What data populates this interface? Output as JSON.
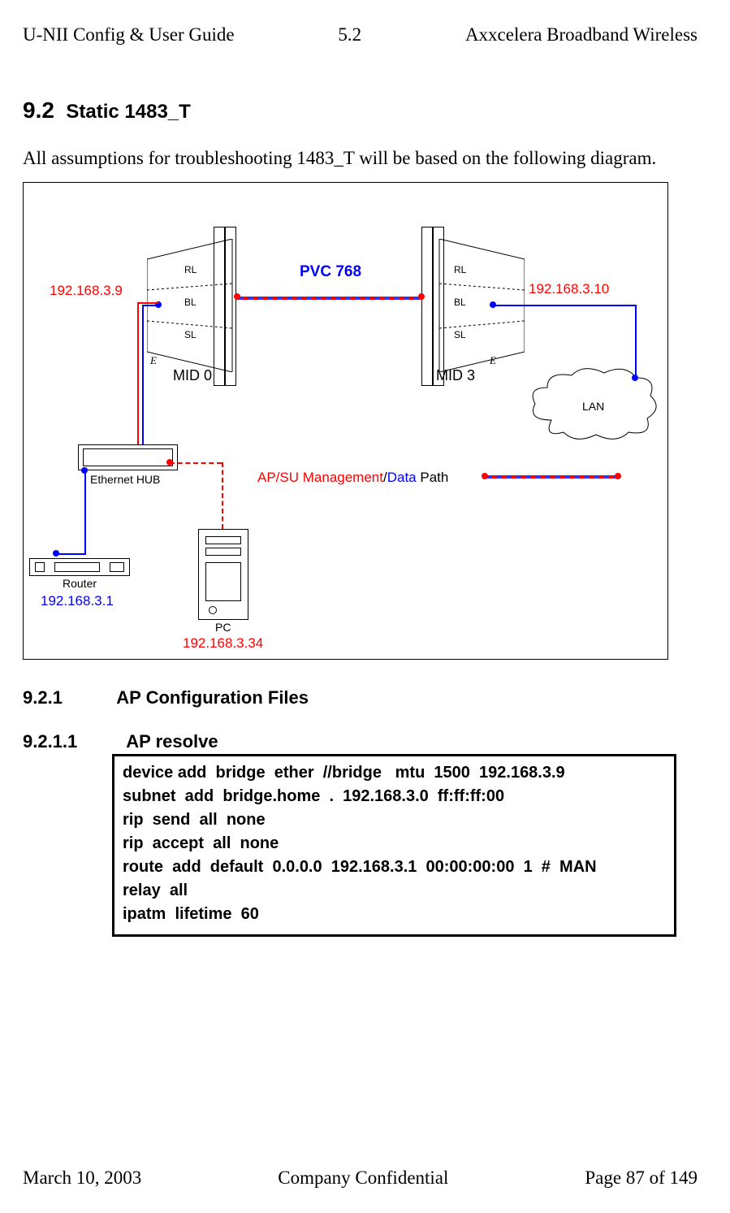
{
  "header": {
    "left": "U-NII Config & User Guide",
    "center": "5.2",
    "right": "Axxcelera Broadband Wireless"
  },
  "sec92": {
    "num": "9.2",
    "title": "Static 1483_T"
  },
  "intro": "All assumptions for troubleshooting 1483_T will be based on the following diagram.",
  "diagram": {
    "pvc": "PVC 768",
    "ip_ap": "192.168.3.9",
    "ip_su": "192.168.3.10",
    "e1": "E",
    "e2": "E",
    "mid0": "MID 0",
    "mid3": "MID 3",
    "rl1": "RL",
    "bl1": "BL",
    "sl1": "SL",
    "rl2": "RL",
    "bl2": "BL",
    "sl2": "SL",
    "hub_label": "Ethernet HUB",
    "path_ap": "AP/SU  ",
    "path_m": "Management",
    "path_sep": "/",
    "path_d": "Data ",
    "path_p": "Path",
    "router_label": "Router",
    "router_ip": "192.168.3.1",
    "pc_label": "PC",
    "pc_ip": "192.168.3.34",
    "lan": "LAN"
  },
  "sec921": {
    "num": "9.2.1",
    "title": "AP Configuration Files"
  },
  "sec9211": {
    "num": "9.2.1.1",
    "title": "AP resolve"
  },
  "code": "device add  bridge  ether  //bridge   mtu  1500  192.168.3.9\nsubnet  add  bridge.home  .  192.168.3.0  ff:ff:ff:00\nrip  send  all  none\nrip  accept  all  none\nroute  add  default  0.0.0.0  192.168.3.1  00:00:00:00  1  #  MAN\nrelay  all\nipatm  lifetime  60",
  "footer": {
    "left": "March 10, 2003",
    "center": "Company Confidential",
    "right": "Page 87 of 149"
  }
}
